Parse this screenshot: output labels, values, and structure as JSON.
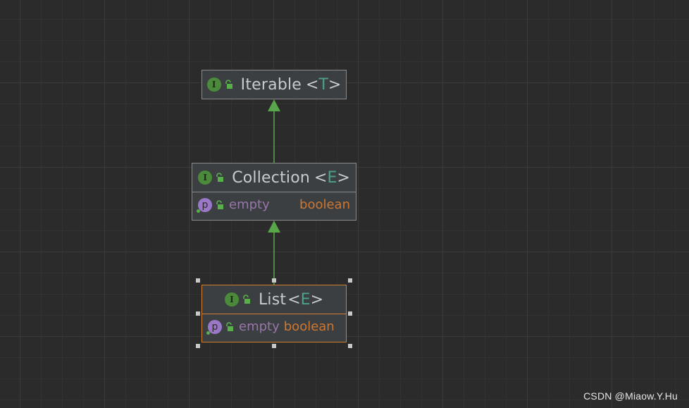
{
  "diagram": {
    "nodes": [
      {
        "id": "iterable",
        "name": "Iterable",
        "type_param": "T",
        "kind_icon": "interface-icon",
        "kind_letter": "I",
        "access_icon": "unlocked-public-icon",
        "selected": false,
        "fields": []
      },
      {
        "id": "collection",
        "name": "Collection",
        "type_param": "E",
        "kind_icon": "interface-icon",
        "kind_letter": "I",
        "access_icon": "unlocked-public-icon",
        "selected": false,
        "fields": [
          {
            "badge": "p",
            "name": "empty",
            "type": "boolean"
          }
        ]
      },
      {
        "id": "list",
        "name": "List",
        "type_param": "E",
        "kind_icon": "interface-icon",
        "kind_letter": "I",
        "access_icon": "unlocked-public-icon",
        "selected": true,
        "fields": [
          {
            "badge": "p",
            "name": "empty",
            "type": "boolean"
          }
        ]
      }
    ],
    "edges": [
      {
        "from": "collection",
        "to": "iterable",
        "kind": "extends"
      },
      {
        "from": "list",
        "to": "collection",
        "kind": "extends"
      }
    ]
  },
  "colors": {
    "background": "#2b2b2b",
    "node_fill": "#3c3f41",
    "node_border": "#8a8a8a",
    "selected_border": "#d0802e",
    "edge": "#57a64a",
    "interface_badge": "#4a8a3a",
    "property_badge": "#9b77c7",
    "field_name": "#9876aa",
    "field_type": "#cc7832",
    "type_param": "#4ea08d"
  },
  "watermark": "CSDN @Miaow.Y.Hu"
}
